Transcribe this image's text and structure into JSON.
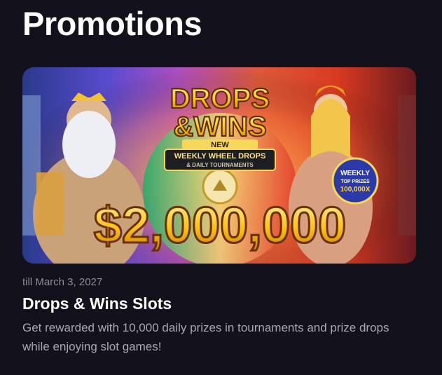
{
  "page": {
    "title": "Promotions"
  },
  "promotion": {
    "banner": {
      "headline_line1": "DROPS",
      "headline_line2": "&WINS",
      "badge_new": "NEW",
      "ribbon_line1": "WEEKLY WHEEL DROPS",
      "ribbon_line2": "& DAILY TOURNAMENTS",
      "prize_amount": "$2,000,000",
      "seal_line1": "WEEKLY",
      "seal_line2": "TOP PRIZES",
      "seal_line3": "100,000X"
    },
    "date": "till March 3, 2027",
    "title": "Drops & Wins Slots",
    "description": "Get rewarded with 10,000 daily prizes in tournaments and prize drops while enjoying slot games!"
  }
}
